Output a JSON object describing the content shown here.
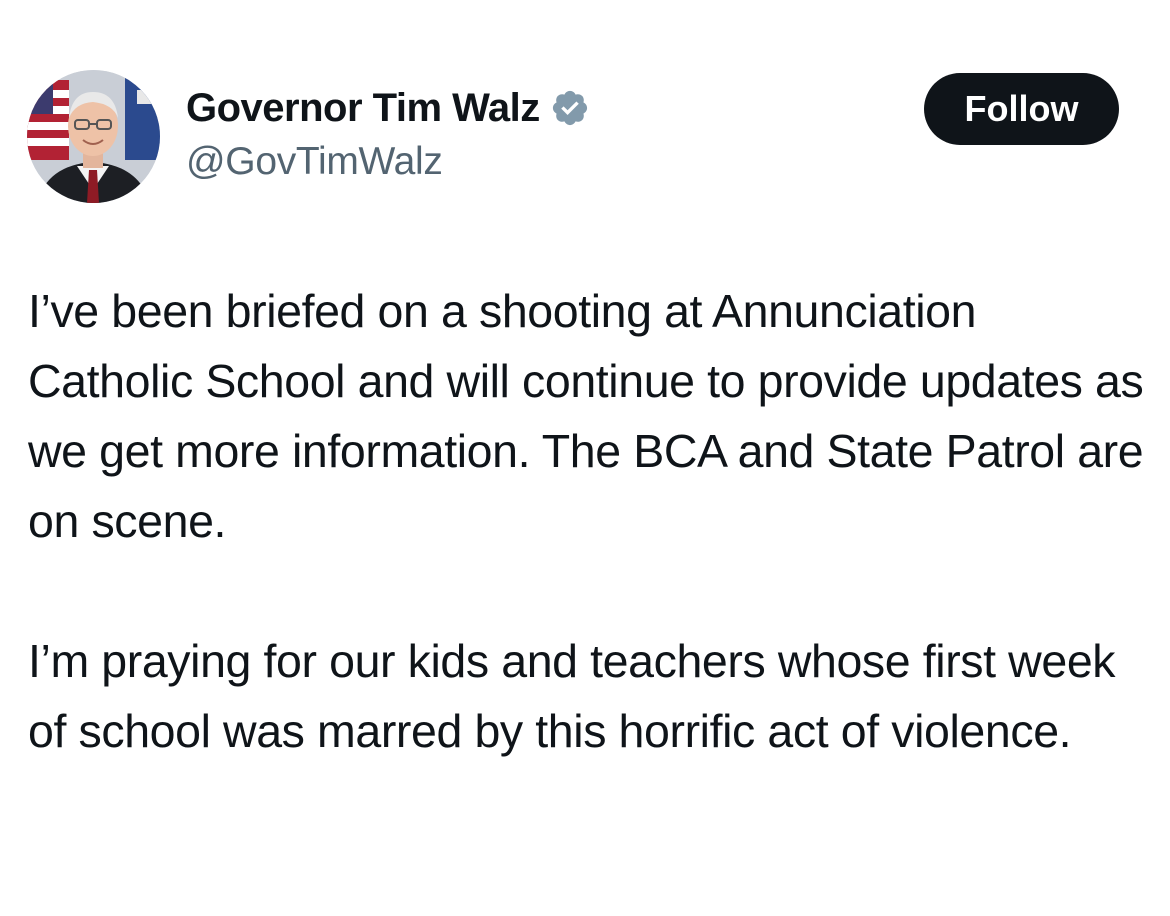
{
  "author": {
    "display_name": "Governor Tim Walz",
    "handle": "@GovTimWalz",
    "verified_icon": "verified-badge-icon",
    "verified_color": "#829aab"
  },
  "actions": {
    "follow_label": "Follow"
  },
  "tweet": {
    "paragraphs": [
      "I’ve been briefed on a shooting at Annunciation Catholic School and will continue to provide updates as we get more information. The BCA and State Patrol are on scene.",
      "I’m praying for our kids and teachers whose first week of school was marred by this horrific act of violence."
    ]
  },
  "colors": {
    "text_primary": "#0f1419",
    "text_secondary": "#536471",
    "button_bg": "#0f1419",
    "button_text": "#ffffff",
    "background": "#ffffff"
  }
}
